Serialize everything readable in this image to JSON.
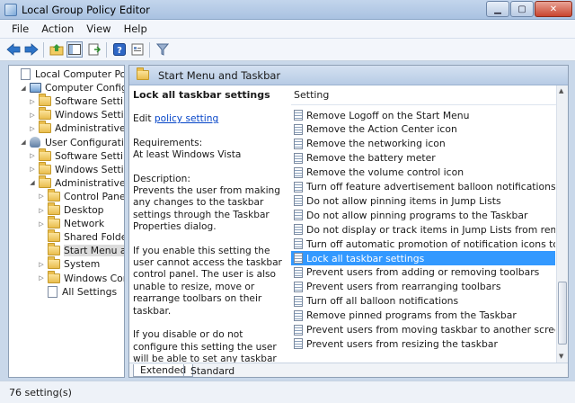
{
  "window": {
    "title": "Local Group Policy Editor"
  },
  "menu": [
    "File",
    "Action",
    "View",
    "Help"
  ],
  "icons": {
    "back": "arrow-left-icon",
    "forward": "arrow-right-icon",
    "up": "folder-up-icon",
    "show_hide": "show-hide-tree-icon",
    "export": "export-list-icon",
    "help": "help-icon",
    "properties": "properties-icon",
    "filter": "filter-icon"
  },
  "colors": {
    "selection": "#3399ff",
    "link": "#0645c8",
    "header": "#c9d8ea"
  },
  "tree": [
    {
      "label": "Local Computer Policy",
      "indent": 0,
      "icon": "doc",
      "exp": ""
    },
    {
      "label": "Computer Configuration",
      "indent": 1,
      "icon": "pc",
      "exp": "◢"
    },
    {
      "label": "Software Settings",
      "indent": 2,
      "icon": "folder",
      "exp": "▷"
    },
    {
      "label": "Windows Settings",
      "indent": 2,
      "icon": "folder",
      "exp": "▷"
    },
    {
      "label": "Administrative Temp",
      "indent": 2,
      "icon": "folder",
      "exp": "▷"
    },
    {
      "label": "User Configuration",
      "indent": 1,
      "icon": "user",
      "exp": "◢"
    },
    {
      "label": "Software Settings",
      "indent": 2,
      "icon": "folder",
      "exp": "▷"
    },
    {
      "label": "Windows Settings",
      "indent": 2,
      "icon": "folder",
      "exp": "▷"
    },
    {
      "label": "Administrative Temp",
      "indent": 2,
      "icon": "folder",
      "exp": "◢"
    },
    {
      "label": "Control Panel",
      "indent": 3,
      "icon": "folder",
      "exp": "▷"
    },
    {
      "label": "Desktop",
      "indent": 3,
      "icon": "folder",
      "exp": "▷"
    },
    {
      "label": "Network",
      "indent": 3,
      "icon": "folder",
      "exp": "▷"
    },
    {
      "label": "Shared Folders",
      "indent": 3,
      "icon": "folder",
      "exp": ""
    },
    {
      "label": "Start Menu and T",
      "indent": 3,
      "icon": "folder",
      "exp": "",
      "selected": true
    },
    {
      "label": "System",
      "indent": 3,
      "icon": "folder",
      "exp": "▷"
    },
    {
      "label": "Windows Compo",
      "indent": 3,
      "icon": "folder",
      "exp": "▷"
    },
    {
      "label": "All Settings",
      "indent": 3,
      "icon": "doc",
      "exp": ""
    }
  ],
  "pane": {
    "header": "Start Menu and Taskbar",
    "desc_title": "Lock all taskbar settings",
    "edit_prefix": "Edit ",
    "edit_link": "policy setting",
    "req_label": "Requirements:",
    "req_value": "At least Windows Vista",
    "desc_label": "Description:",
    "desc_text": "Prevents the user from making any changes to the taskbar settings through the Taskbar Properties dialog.",
    "enabled_text": "If you enable this setting the user cannot access the taskbar control panel. The user is also unable to resize, move or rearrange toolbars on their taskbar.",
    "disabled_text": "If you disable or do not configure this setting the user will be able to set any taskbar setting that is not disallowed by another policy setting."
  },
  "settings": {
    "column": "Setting",
    "items": [
      "Remove Logoff on the Start Menu",
      "Remove the Action Center icon",
      "Remove the networking icon",
      "Remove the battery meter",
      "Remove the volume control icon",
      "Turn off feature advertisement balloon notifications",
      "Do not allow pinning items in Jump Lists",
      "Do not allow pinning programs to the Taskbar",
      "Do not display or track items in Jump Lists from remote loca...",
      "Turn off automatic promotion of notification icons to the ta...",
      "Lock all taskbar settings",
      "Prevent users from adding or removing toolbars",
      "Prevent users from rearranging toolbars",
      "Turn off all balloon notifications",
      "Remove pinned programs from the Taskbar",
      "Prevent users from moving taskbar to another screen dock l...",
      "Prevent users from resizing the taskbar"
    ],
    "selected_index": 10
  },
  "tabs": [
    "Extended",
    "Standard"
  ],
  "status": "76 setting(s)"
}
